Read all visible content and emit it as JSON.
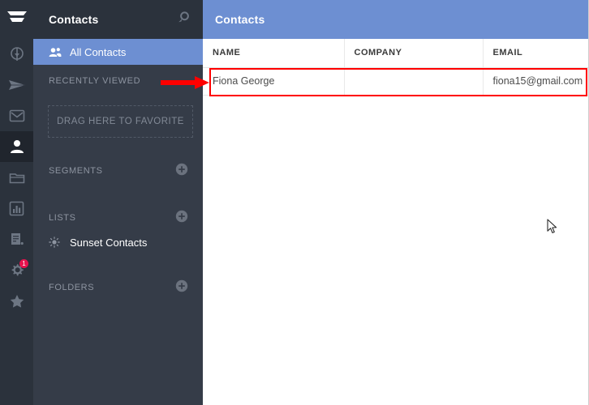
{
  "rail": {
    "logo": {
      "name": "app-logo",
      "icon": "stacked-bars-logo"
    },
    "items": [
      {
        "icon": "compass-icon",
        "name": "dashboard",
        "active": false,
        "badge": null
      },
      {
        "icon": "paper-plane-icon",
        "name": "campaigns",
        "active": false,
        "badge": null
      },
      {
        "icon": "envelope-icon",
        "name": "messages",
        "active": false,
        "badge": null
      },
      {
        "icon": "person-icon",
        "name": "contacts",
        "active": true,
        "badge": null
      },
      {
        "icon": "folder-icon",
        "name": "files",
        "active": false,
        "badge": null
      },
      {
        "icon": "bar-chart-icon",
        "name": "reports",
        "active": false,
        "badge": null
      },
      {
        "icon": "document-icon",
        "name": "forms",
        "active": false,
        "badge": null
      },
      {
        "icon": "gear-icon",
        "name": "settings",
        "active": false,
        "badge": "1"
      },
      {
        "icon": "star-icon",
        "name": "favorites",
        "active": false,
        "badge": null
      }
    ]
  },
  "sidebar": {
    "title": "Contacts",
    "search_icon": "search-icon",
    "all_contacts": {
      "label": "All Contacts",
      "icon": "people-icon",
      "selected": true
    },
    "recently_viewed_label": "RECENTLY VIEWED",
    "favorite_dropzone_label": "DRAG HERE TO FAVORITE",
    "groups": [
      {
        "label": "SEGMENTS",
        "add_icon": "plus-circle-icon",
        "items": []
      },
      {
        "label": "LISTS",
        "add_icon": "plus-circle-icon",
        "items": [
          {
            "label": "Sunset Contacts",
            "icon": "sun-icon"
          }
        ]
      },
      {
        "label": "FOLDERS",
        "add_icon": "plus-circle-icon",
        "items": []
      }
    ]
  },
  "main": {
    "header_title": "Contacts",
    "table": {
      "columns": [
        "NAME",
        "COMPANY",
        "EMAIL"
      ],
      "rows": [
        {
          "name": "Fiona George",
          "company": "",
          "email": "fiona15@gmail.com"
        }
      ]
    }
  },
  "annotations": {
    "highlight_color": "#ff0000",
    "arrow_color": "#ff0000",
    "highlighted_row_label": "Fiona George",
    "cursor_position": "679, 278"
  },
  "colors": {
    "rail_bg": "#2b323c",
    "sidebar_bg": "#353c48",
    "accent_blue": "#6d8fd2",
    "badge_red": "#e8124e",
    "content_bg": "#ffffff"
  }
}
